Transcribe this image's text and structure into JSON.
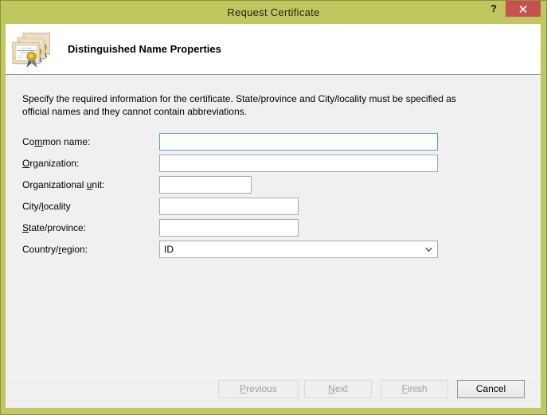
{
  "window": {
    "title": "Request Certificate",
    "help_glyph": "?"
  },
  "header": {
    "title": "Distinguished Name Properties",
    "icon": "certificates-icon"
  },
  "intro": {
    "line1": "Specify the required information for the certificate. State/province and City/locality must be specified as",
    "line2": "official names and they cannot contain abbreviations."
  },
  "form": {
    "fields": [
      {
        "label_pre": "Co",
        "label_accel": "m",
        "label_post": "mon name:",
        "value": "",
        "focused": true
      },
      {
        "label_pre": "",
        "label_accel": "O",
        "label_post": "rganization:",
        "value": "",
        "focused": false
      },
      {
        "label_pre": "Organizational ",
        "label_accel": "u",
        "label_post": "nit:",
        "value": "",
        "focused": false
      },
      {
        "label_pre": "City/",
        "label_accel": "l",
        "label_post": "ocality",
        "value": "",
        "focused": false
      },
      {
        "label_pre": "",
        "label_accel": "S",
        "label_post": "tate/province:",
        "value": "",
        "focused": false
      },
      {
        "label_pre": "Country/",
        "label_accel": "r",
        "label_post": "egion:",
        "value": "ID",
        "focused": false
      }
    ]
  },
  "footer": {
    "buttons": [
      {
        "pre": "",
        "accel": "P",
        "post": "revious",
        "disabled": true
      },
      {
        "pre": "",
        "accel": "N",
        "post": "ext",
        "disabled": true
      },
      {
        "pre": "",
        "accel": "F",
        "post": "inish",
        "disabled": true
      },
      {
        "pre": "Cancel",
        "accel": "",
        "post": "",
        "disabled": false
      }
    ]
  },
  "colors": {
    "titlebar": "#BFC75E",
    "frame_border": "#8C923F",
    "close_button": "#C75050",
    "body": "#F0F0F0",
    "focused_input_border": "#569DE5",
    "input_border": "#ABABAB"
  }
}
